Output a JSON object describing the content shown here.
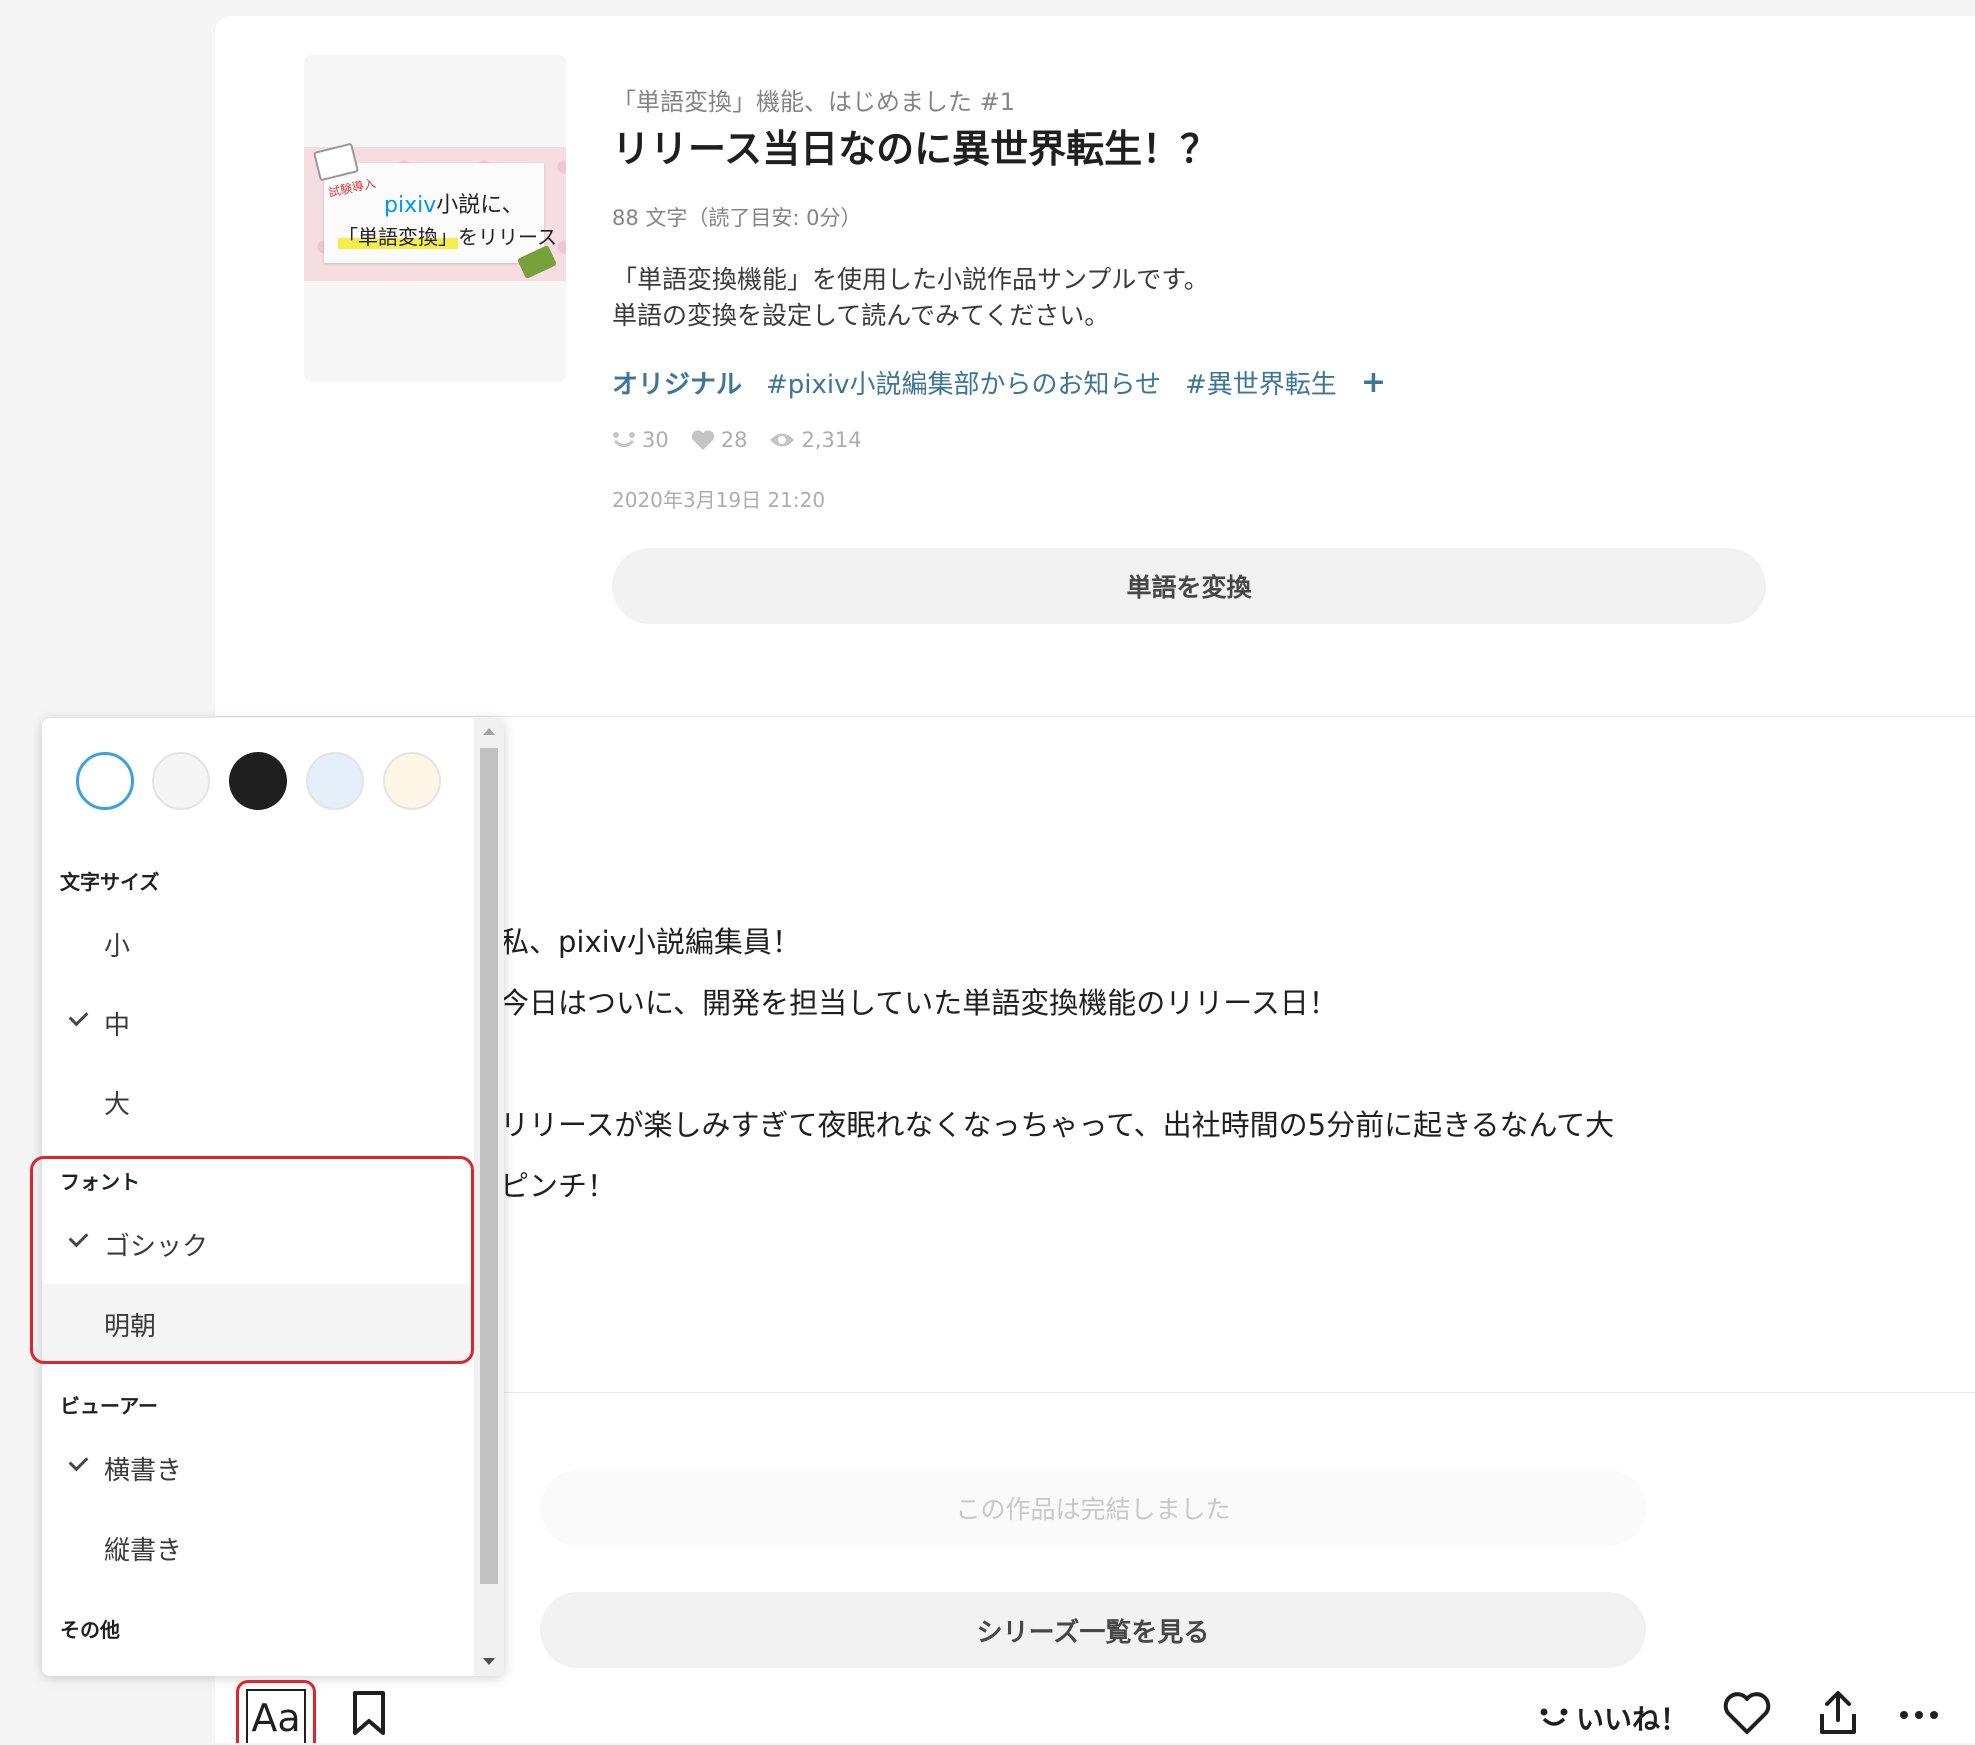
{
  "work": {
    "series_title": "「単語変換」機能、はじめました #1",
    "title": "リリース当日なのに異世界転生！？",
    "char_count": "88 文字（読了目安: 0分）",
    "caption_line1": "「単語変換機能」を使用した小説作品サンプルです。",
    "caption_line2": "単語の変換を設定して読んでみてください。",
    "tags": [
      "オリジナル",
      "#pixiv小説編集部からのお知らせ",
      "#異世界転生"
    ],
    "tag_add": "+",
    "stats": {
      "reactions": "30",
      "likes": "28",
      "views": "2,314"
    },
    "date": "2020年3月19日 21:20",
    "convert_button": "単語を変換"
  },
  "cover": {
    "badge": "試験導入",
    "brand": "pixiv",
    "line1_suffix": "小説に、",
    "line2_highlight": "「単語変換」",
    "line2_suffix": "をリリース"
  },
  "body": {
    "line1": "私、pixiv小説編集員！",
    "line2": "今日はついに、開発を担当していた単語変換機能のリリース日！",
    "line3": "リリースが楽しみすぎて夜眠れなくなっちゃって、出社時間の5分前に起きるなんて大",
    "line4": "ピンチ！"
  },
  "footer": {
    "finished": "この作品は完結しました",
    "series_list_button": "シリーズ一覧を見る",
    "like_label": "いいね！"
  },
  "settings": {
    "theme_colors": [
      "#ffffff",
      "#f5f5f5",
      "#1f1f1f",
      "#e3eef9",
      "#fdf6e6"
    ],
    "selected_theme_ring": "#3ea0e4",
    "font_size": {
      "label": "文字サイズ",
      "options": [
        "小",
        "中",
        "大"
      ],
      "selected": "中"
    },
    "font": {
      "label": "フォント",
      "options": [
        "ゴシック",
        "明朝"
      ],
      "selected": "ゴシック"
    },
    "viewer": {
      "label": "ビューアー",
      "options": [
        "横書き",
        "縦書き"
      ],
      "selected": "横書き"
    },
    "other": {
      "label": "その他"
    }
  },
  "toolbar": {
    "aa_label": "Aa"
  },
  "colors": {
    "tag": "#3d7699",
    "highlight": "#e0242b",
    "brand": "#0096fa"
  }
}
